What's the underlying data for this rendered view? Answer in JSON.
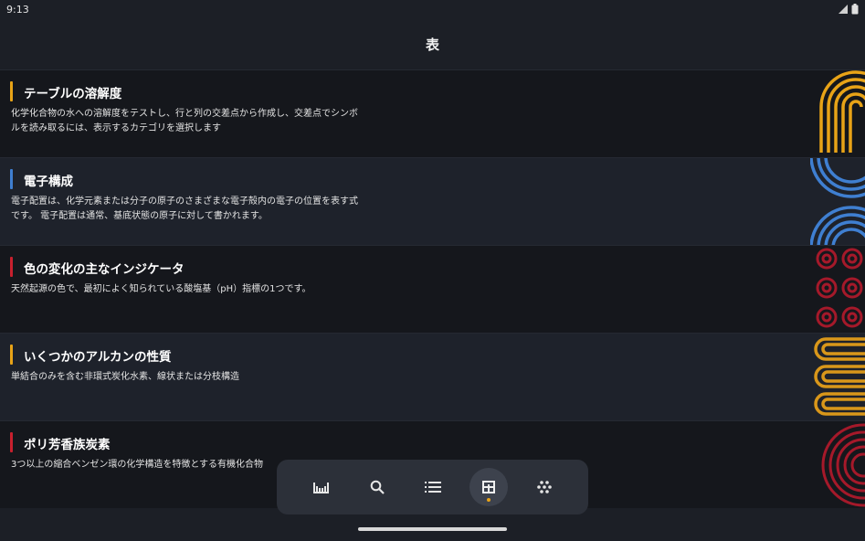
{
  "status": {
    "time": "9:13"
  },
  "header": {
    "title": "表"
  },
  "rows": [
    {
      "title": "テーブルの溶解度",
      "desc": "化学化合物の水への溶解度をテストし、行と列の交差点から作成し、交差点でシンボルを読み取るには、表示するカテゴリを選択します",
      "accent": "#e8a317"
    },
    {
      "title": "電子構成",
      "desc": "電子配置は、化学元素または分子の原子のさまざまな電子殻内の電子の位置を表す式です。 電子配置は通常、基底状態の原子に対して書かれます。",
      "accent": "#3f7fd1"
    },
    {
      "title": "色の変化の主なインジケータ",
      "desc": "天然起源の色で、最初によく知られている酸塩基（pH）指標の1つです。",
      "accent": "#c8202e"
    },
    {
      "title": "いくつかのアルカンの性質",
      "desc": "単結合のみを含む非環式炭化水素、線状または分枝構造",
      "accent": "#e8a317"
    },
    {
      "title": "ポリ芳香族炭素",
      "desc": "3つ以上の縮合ベンゼン環の化学構造を特徴とする有機化合物",
      "accent": "#c8202e"
    }
  ],
  "nav": {
    "items": [
      {
        "icon": "periodic-chart-icon"
      },
      {
        "icon": "search-icon"
      },
      {
        "icon": "list-icon"
      },
      {
        "icon": "table-icon",
        "active": true
      },
      {
        "icon": "molecule-icon"
      }
    ]
  }
}
